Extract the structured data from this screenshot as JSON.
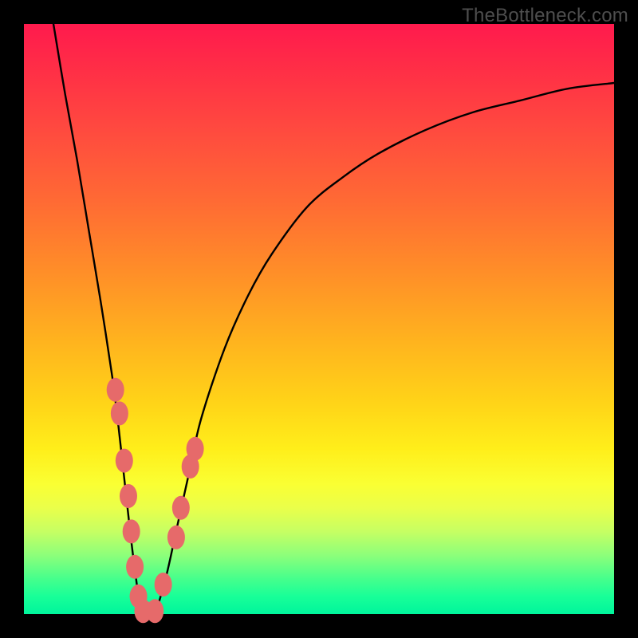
{
  "watermark": "TheBottleneck.com",
  "chart_data": {
    "type": "line",
    "title": "",
    "xlabel": "",
    "ylabel": "",
    "xlim": [
      0,
      100
    ],
    "ylim": [
      0,
      100
    ],
    "series": [
      {
        "name": "curve",
        "x": [
          5,
          7,
          9,
          11,
          13,
          15,
          16,
          17,
          18,
          19,
          20,
          22,
          24,
          26,
          28,
          30,
          34,
          38,
          42,
          48,
          54,
          60,
          68,
          76,
          84,
          92,
          100
        ],
        "y": [
          100,
          88,
          77,
          65,
          53,
          40,
          32,
          23,
          14,
          6,
          0,
          0,
          6,
          15,
          24,
          33,
          45,
          54,
          61,
          69,
          74,
          78,
          82,
          85,
          87,
          89,
          90
        ]
      }
    ],
    "markers": [
      {
        "x": 15.5,
        "y": 38
      },
      {
        "x": 16.2,
        "y": 34
      },
      {
        "x": 17.0,
        "y": 26
      },
      {
        "x": 17.7,
        "y": 20
      },
      {
        "x": 18.2,
        "y": 14
      },
      {
        "x": 18.8,
        "y": 8
      },
      {
        "x": 19.4,
        "y": 3
      },
      {
        "x": 20.2,
        "y": 0.5
      },
      {
        "x": 22.2,
        "y": 0.5
      },
      {
        "x": 23.6,
        "y": 5
      },
      {
        "x": 25.8,
        "y": 13
      },
      {
        "x": 26.6,
        "y": 18
      },
      {
        "x": 28.2,
        "y": 25
      },
      {
        "x": 29.0,
        "y": 28
      }
    ],
    "colors": {
      "curve_stroke": "#000000",
      "marker_fill": "#e66a6a"
    }
  }
}
